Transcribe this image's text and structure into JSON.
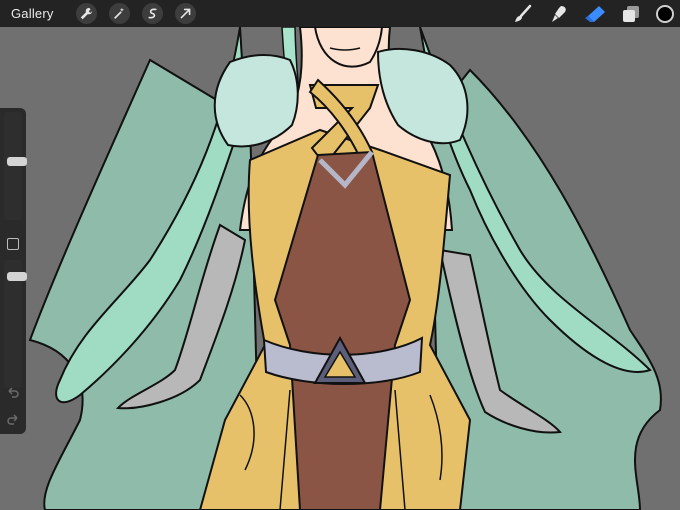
{
  "topbar": {
    "gallery_label": "Gallery",
    "left_tools": [
      "wrench-icon",
      "magic-wand-icon",
      "selection-icon",
      "transform-arrow-icon"
    ],
    "right_tools": [
      "brush-icon",
      "smudge-icon",
      "eraser-icon",
      "layers-icon"
    ],
    "active_tool": "eraser-icon",
    "current_color": "#000000",
    "accent": "#3b8cff"
  },
  "sidebar": {
    "brush_size_level": 0.55,
    "opacity_level": 0.9
  }
}
